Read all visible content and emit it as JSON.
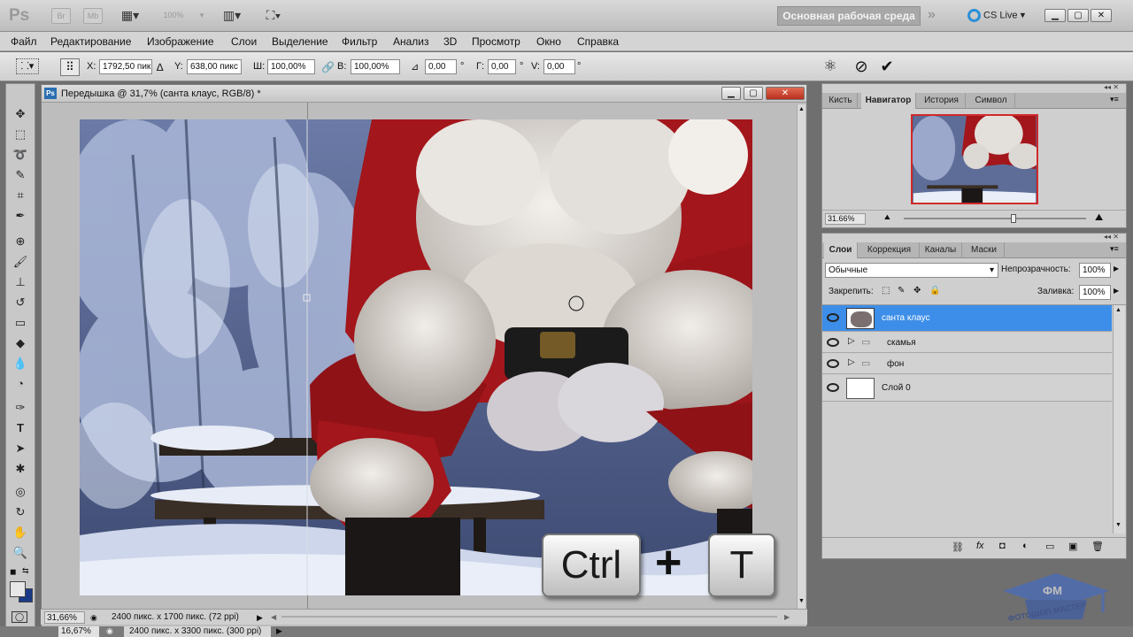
{
  "app": {
    "logo": "Ps",
    "bar_buttons": [
      "Br",
      "Mb",
      "100%"
    ],
    "workspace": "Основная рабочая среда",
    "cslive": "CS Live"
  },
  "menu": [
    "Файл",
    "Редактирование",
    "Изображение",
    "Слои",
    "Выделение",
    "Фильтр",
    "Анализ",
    "3D",
    "Просмотр",
    "Окно",
    "Справка"
  ],
  "options": {
    "x_label": "X:",
    "x_value": "1792,50 пик",
    "y_label": "Y:",
    "y_value": "638,00 пикс",
    "w_label": "Ш:",
    "w_value": "100,00%",
    "h_label": "В:",
    "h_value": "100,00%",
    "angle_value": "0,00",
    "angle_unit": "°",
    "hskew_label": "Г:",
    "hskew_value": "0,00",
    "hskew_unit": "°",
    "vskew_label": "V:",
    "vskew_value": "0,00",
    "vskew_unit": "°"
  },
  "document": {
    "title": "Передышка @ 31,7% (санта клаус, RGB/8) *",
    "zoom": "31,66%",
    "info": "2400 пикс. x 1700 пикс. (72 ppi)"
  },
  "background_document": {
    "zoom": "16,67%",
    "info": "2400 пикс. x 3300 пикс. (300 ppi)"
  },
  "navigator": {
    "tabs": [
      "Кисть",
      "Навигатор",
      "История",
      "Символ"
    ],
    "active_tab": "Навигатор",
    "zoom": "31.66%",
    "zoom_slider_level": 0.6
  },
  "layers": {
    "tabs": [
      "Слои",
      "Коррекция",
      "Каналы",
      "Маски"
    ],
    "active_tab": "Слои",
    "blend_mode": "Обычные",
    "opacity_label": "Непрозрачность:",
    "opacity_value": "100%",
    "lock_label": "Закрепить:",
    "fill_label": "Заливка:",
    "fill_value": "100%",
    "items": [
      {
        "name": "санта клаус",
        "type": "layer",
        "selected": true
      },
      {
        "name": "скамья",
        "type": "group",
        "selected": false
      },
      {
        "name": "фон",
        "type": "group",
        "selected": false
      },
      {
        "name": "Слой 0",
        "type": "layer",
        "selected": false
      }
    ]
  },
  "overlay": {
    "key1": "Ctrl",
    "plus": "+",
    "key2": "T",
    "watermark_top": "ФМ",
    "watermark_text": "ФОТОШОП МАСТЕР"
  },
  "colors": {
    "accent_selected": "#3d8ee8",
    "canvas_snow": "#5a6b95",
    "santa_red": "#a3161b"
  }
}
